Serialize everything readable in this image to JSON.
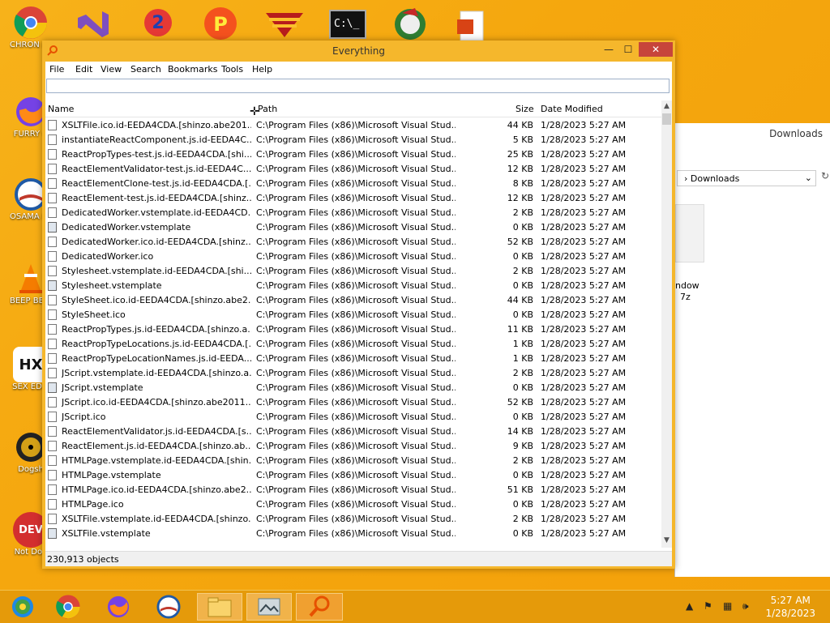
{
  "desktop": {
    "icons": [
      {
        "label": "CHRON DISEAS"
      },
      {
        "label": "FURRY C"
      },
      {
        "label": "OSAMA LADEN B"
      },
      {
        "label": "BEEP BE CAR"
      },
      {
        "label": "SEX EDIT"
      },
      {
        "label": "Dogsh"
      },
      {
        "label": "Not Dog"
      }
    ],
    "background_window": {
      "title": "Downloads",
      "address": "Downloads",
      "file_label_1": "ndow",
      "file_label_2": "7z"
    }
  },
  "window": {
    "title": "Everything",
    "minimize": "—",
    "maximize": "☐",
    "close": "✕",
    "menu": [
      "File",
      "Edit",
      "View",
      "Search",
      "Bookmarks",
      "Tools",
      "Help"
    ],
    "search_value": "",
    "columns": {
      "name": "Name",
      "path": "Path",
      "size": "Size",
      "date": "Date Modified"
    },
    "rows": [
      {
        "name": "XSLTFile.ico.id-EEDA4CDA.[shinzo.abe201...",
        "path": "C:\\Program Files (x86)\\Microsoft Visual Stud...",
        "size": "44 KB",
        "date": "1/28/2023 5:27 AM",
        "icon": "doc"
      },
      {
        "name": "instantiateReactComponent.js.id-EEDA4C...",
        "path": "C:\\Program Files (x86)\\Microsoft Visual Stud...",
        "size": "5 KB",
        "date": "1/28/2023 5:27 AM",
        "icon": "doc"
      },
      {
        "name": "ReactPropTypes-test.js.id-EEDA4CDA.[shi...",
        "path": "C:\\Program Files (x86)\\Microsoft Visual Stud...",
        "size": "25 KB",
        "date": "1/28/2023 5:27 AM",
        "icon": "doc"
      },
      {
        "name": "ReactElementValidator-test.js.id-EEDA4C...",
        "path": "C:\\Program Files (x86)\\Microsoft Visual Stud...",
        "size": "12 KB",
        "date": "1/28/2023 5:27 AM",
        "icon": "doc"
      },
      {
        "name": "ReactElementClone-test.js.id-EEDA4CDA.[...",
        "path": "C:\\Program Files (x86)\\Microsoft Visual Stud...",
        "size": "8 KB",
        "date": "1/28/2023 5:27 AM",
        "icon": "doc"
      },
      {
        "name": "ReactElement-test.js.id-EEDA4CDA.[shinz...",
        "path": "C:\\Program Files (x86)\\Microsoft Visual Stud...",
        "size": "12 KB",
        "date": "1/28/2023 5:27 AM",
        "icon": "doc"
      },
      {
        "name": "DedicatedWorker.vstemplate.id-EEDA4CD...",
        "path": "C:\\Program Files (x86)\\Microsoft Visual Stud...",
        "size": "2 KB",
        "date": "1/28/2023 5:27 AM",
        "icon": "doc"
      },
      {
        "name": "DedicatedWorker.vstemplate",
        "path": "C:\\Program Files (x86)\\Microsoft Visual Stud...",
        "size": "0 KB",
        "date": "1/28/2023 5:27 AM",
        "icon": "img"
      },
      {
        "name": "DedicatedWorker.ico.id-EEDA4CDA.[shinz...",
        "path": "C:\\Program Files (x86)\\Microsoft Visual Stud...",
        "size": "52 KB",
        "date": "1/28/2023 5:27 AM",
        "icon": "doc"
      },
      {
        "name": "DedicatedWorker.ico",
        "path": "C:\\Program Files (x86)\\Microsoft Visual Stud...",
        "size": "0 KB",
        "date": "1/28/2023 5:27 AM",
        "icon": "doc"
      },
      {
        "name": "Stylesheet.vstemplate.id-EEDA4CDA.[shi...",
        "path": "C:\\Program Files (x86)\\Microsoft Visual Stud...",
        "size": "2 KB",
        "date": "1/28/2023 5:27 AM",
        "icon": "doc"
      },
      {
        "name": "Stylesheet.vstemplate",
        "path": "C:\\Program Files (x86)\\Microsoft Visual Stud...",
        "size": "0 KB",
        "date": "1/28/2023 5:27 AM",
        "icon": "img"
      },
      {
        "name": "StyleSheet.ico.id-EEDA4CDA.[shinzo.abe2...",
        "path": "C:\\Program Files (x86)\\Microsoft Visual Stud...",
        "size": "44 KB",
        "date": "1/28/2023 5:27 AM",
        "icon": "doc"
      },
      {
        "name": "StyleSheet.ico",
        "path": "C:\\Program Files (x86)\\Microsoft Visual Stud...",
        "size": "0 KB",
        "date": "1/28/2023 5:27 AM",
        "icon": "doc"
      },
      {
        "name": "ReactPropTypes.js.id-EEDA4CDA.[shinzo.a...",
        "path": "C:\\Program Files (x86)\\Microsoft Visual Stud...",
        "size": "11 KB",
        "date": "1/28/2023 5:27 AM",
        "icon": "doc"
      },
      {
        "name": "ReactPropTypeLocations.js.id-EEDA4CDA.[...",
        "path": "C:\\Program Files (x86)\\Microsoft Visual Stud...",
        "size": "1 KB",
        "date": "1/28/2023 5:27 AM",
        "icon": "doc"
      },
      {
        "name": "ReactPropTypeLocationNames.js.id-EEDA...",
        "path": "C:\\Program Files (x86)\\Microsoft Visual Stud...",
        "size": "1 KB",
        "date": "1/28/2023 5:27 AM",
        "icon": "doc"
      },
      {
        "name": "JScript.vstemplate.id-EEDA4CDA.[shinzo.a...",
        "path": "C:\\Program Files (x86)\\Microsoft Visual Stud...",
        "size": "2 KB",
        "date": "1/28/2023 5:27 AM",
        "icon": "doc"
      },
      {
        "name": "JScript.vstemplate",
        "path": "C:\\Program Files (x86)\\Microsoft Visual Stud...",
        "size": "0 KB",
        "date": "1/28/2023 5:27 AM",
        "icon": "img"
      },
      {
        "name": "JScript.ico.id-EEDA4CDA.[shinzo.abe2011...",
        "path": "C:\\Program Files (x86)\\Microsoft Visual Stud...",
        "size": "52 KB",
        "date": "1/28/2023 5:27 AM",
        "icon": "doc"
      },
      {
        "name": "JScript.ico",
        "path": "C:\\Program Files (x86)\\Microsoft Visual Stud...",
        "size": "0 KB",
        "date": "1/28/2023 5:27 AM",
        "icon": "doc"
      },
      {
        "name": "ReactElementValidator.js.id-EEDA4CDA.[s...",
        "path": "C:\\Program Files (x86)\\Microsoft Visual Stud...",
        "size": "14 KB",
        "date": "1/28/2023 5:27 AM",
        "icon": "doc"
      },
      {
        "name": "ReactElement.js.id-EEDA4CDA.[shinzo.ab...",
        "path": "C:\\Program Files (x86)\\Microsoft Visual Stud...",
        "size": "9 KB",
        "date": "1/28/2023 5:27 AM",
        "icon": "doc"
      },
      {
        "name": "HTMLPage.vstemplate.id-EEDA4CDA.[shin...",
        "path": "C:\\Program Files (x86)\\Microsoft Visual Stud...",
        "size": "2 KB",
        "date": "1/28/2023 5:27 AM",
        "icon": "doc"
      },
      {
        "name": "HTMLPage.vstemplate",
        "path": "C:\\Program Files (x86)\\Microsoft Visual Stud...",
        "size": "0 KB",
        "date": "1/28/2023 5:27 AM",
        "icon": "doc"
      },
      {
        "name": "HTMLPage.ico.id-EEDA4CDA.[shinzo.abe2...",
        "path": "C:\\Program Files (x86)\\Microsoft Visual Stud...",
        "size": "51 KB",
        "date": "1/28/2023 5:27 AM",
        "icon": "doc"
      },
      {
        "name": "HTMLPage.ico",
        "path": "C:\\Program Files (x86)\\Microsoft Visual Stud...",
        "size": "0 KB",
        "date": "1/28/2023 5:27 AM",
        "icon": "doc"
      },
      {
        "name": "XSLTFile.vstemplate.id-EEDA4CDA.[shinzo...",
        "path": "C:\\Program Files (x86)\\Microsoft Visual Stud...",
        "size": "2 KB",
        "date": "1/28/2023 5:27 AM",
        "icon": "doc"
      },
      {
        "name": "XSLTFile.vstemplate",
        "path": "C:\\Program Files (x86)\\Microsoft Visual Stud...",
        "size": "0 KB",
        "date": "1/28/2023 5:27 AM",
        "icon": "img"
      }
    ],
    "status": "230,913 objects"
  },
  "taskbar": {
    "apps": [
      "chrome-icon",
      "firefox-icon",
      "obama-logo-icon",
      "file-explorer-icon",
      "picture-viewer-icon",
      "everything-search-icon"
    ],
    "time": "5:27 AM",
    "date": "1/28/2023"
  },
  "colors": {
    "desktop_bg": "#f5a70e",
    "window_frame": "#f5b72c",
    "close_button": "#c7453b",
    "taskbar": "#e59a0a"
  }
}
